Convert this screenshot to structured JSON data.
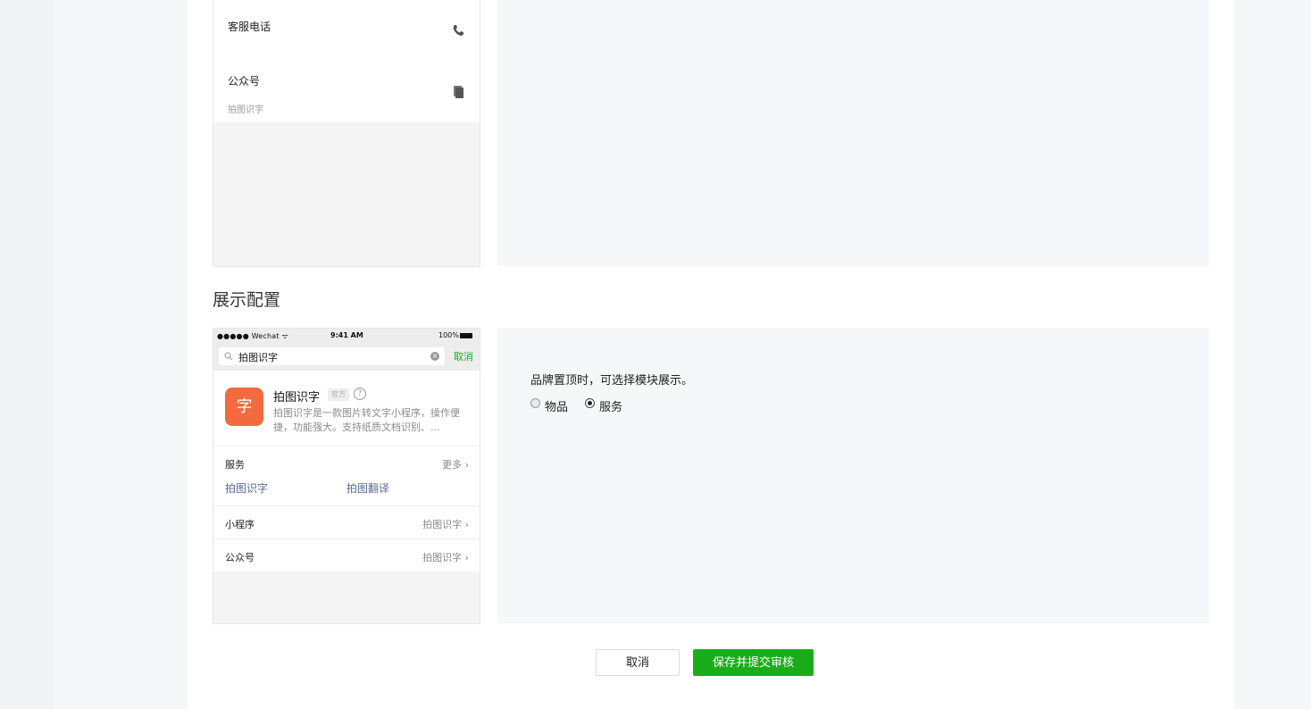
{
  "top_preview": {
    "rows": [
      {
        "title": "客服电话",
        "icon": "phone-icon"
      },
      {
        "title": "公众号",
        "subtitle": "拍图识字",
        "icon": "copy-icon"
      }
    ]
  },
  "section": {
    "title": "展示配置"
  },
  "phone": {
    "status": {
      "carrier": "●●●●● Wechat ᯤ",
      "time": "9:41 AM",
      "battery": "100%"
    },
    "search": {
      "query": "拍图识字",
      "cancel": "取消"
    },
    "app": {
      "logo_glyph": "字",
      "name": "拍图识字",
      "badge": "官方",
      "help": "?",
      "description": "拍图识字是一款图片转文字小程序，操作便捷，功能强大。支持纸质文档识别、..."
    },
    "services": {
      "label": "服务",
      "more": "更多 ›",
      "items": [
        "拍图识字",
        "拍图翻译"
      ]
    },
    "mini_program": {
      "label": "小程序",
      "value": "拍图识字 ›"
    },
    "official_account": {
      "label": "公众号",
      "value": "拍图识字 ›"
    }
  },
  "config": {
    "hint": "品牌置顶时，可选择模块展示。",
    "options": [
      {
        "label": "物品",
        "checked": false
      },
      {
        "label": "服务",
        "checked": true
      }
    ]
  },
  "buttons": {
    "cancel": "取消",
    "save": "保存并提交审核"
  },
  "colors": {
    "accent": "#1aad19",
    "link": "#576b95",
    "panel_bg": "#f6f7f9"
  }
}
